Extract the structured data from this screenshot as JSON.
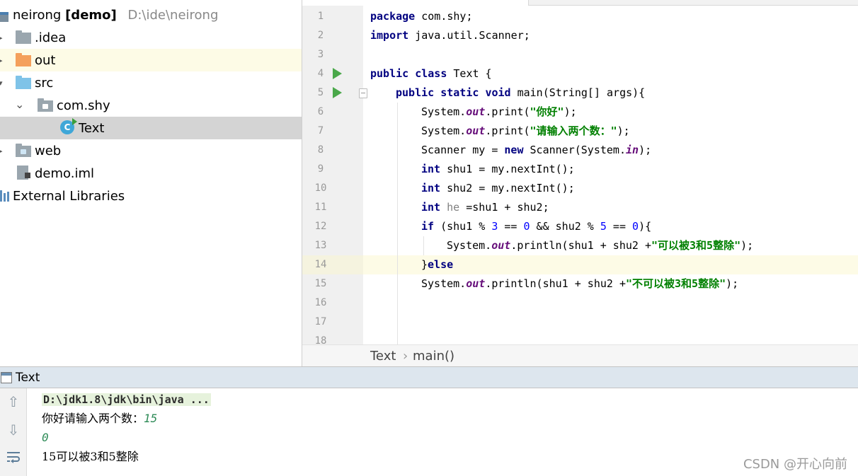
{
  "project_tree": {
    "root_name": "neirong",
    "root_tag": "[demo]",
    "root_path": "D:\\ide\\neirong",
    "items": [
      {
        "label": ".idea"
      },
      {
        "label": "out"
      },
      {
        "label": "src"
      },
      {
        "label": "com.shy"
      },
      {
        "label": "Text",
        "class_icon_letter": "C"
      },
      {
        "label": "web"
      },
      {
        "label": "demo.iml"
      },
      {
        "label": "External Libraries"
      }
    ]
  },
  "editor": {
    "line_numbers": [
      "1",
      "2",
      "3",
      "4",
      "5",
      "6",
      "7",
      "8",
      "9",
      "10",
      "11",
      "12",
      "13",
      "14",
      "15",
      "16",
      "17",
      "18"
    ],
    "current_line": 14,
    "breadcrumb": {
      "class_name": "Text",
      "separator": "›",
      "method": "main()"
    }
  },
  "code": {
    "l1": {
      "kw": "package",
      "rest": " com.shy;"
    },
    "l2": {
      "kw": "import",
      "rest": " java.util.Scanner;"
    },
    "l4": {
      "kw1": "public",
      "kw2": "class",
      "rest": " Text {"
    },
    "l5": {
      "kw1": "public",
      "kw2": "static",
      "kw3": "void",
      "rest": " main(String[] args){"
    },
    "l6": {
      "a": "System.",
      "f": "out",
      "b": ".print(",
      "s": "\"你好\"",
      "c": ");"
    },
    "l7": {
      "a": "System.",
      "f": "out",
      "b": ".print(",
      "s": "\"请输入两个数：\"",
      "c": ");"
    },
    "l8": {
      "a": "Scanner my = ",
      "kw": "new",
      "b": " Scanner(System.",
      "f": "in",
      "c": ");"
    },
    "l9": {
      "kw": "int",
      "rest": " shu1 = my.nextInt();"
    },
    "l10": {
      "kw": "int",
      "rest": " shu2 = my.nextInt();"
    },
    "l11": {
      "kw": "int",
      "var": " he",
      "rest": " =shu1 + shu2;"
    },
    "l12": {
      "kw": "if",
      "a": " (shu1 % ",
      "n1": "3",
      "b": " == ",
      "n2": "0",
      "c": " && shu2 % ",
      "n3": "5",
      "d": " == ",
      "n4": "0",
      "e": "){"
    },
    "l13": {
      "a": "System.",
      "f": "out",
      "b": ".println(shu1 + shu2 +",
      "s": "\"可以被3和5整除\"",
      "c": ");"
    },
    "l14": {
      "a": "}",
      "kw": "else"
    },
    "l15": {
      "a": "System.",
      "f": "out",
      "b": ".println(shu1 + shu2 +",
      "s": "\"不可以被3和5整除\"",
      "c": ");"
    }
  },
  "run_panel": {
    "title": "Text",
    "command": "D:\\jdk1.8\\jdk\\bin\\java ...",
    "output_prompt": "你好请输入两个数：",
    "input1": "15",
    "input2": "0",
    "result": "15可以被3和5整除"
  },
  "watermark": "CSDN @开心向前",
  "colors": {
    "keyword": "#000080",
    "string": "#008000",
    "number": "#0000ff",
    "static_field": "#660e7a",
    "current_line": "#fdfbe6",
    "selected_item": "#d4d4d4"
  }
}
